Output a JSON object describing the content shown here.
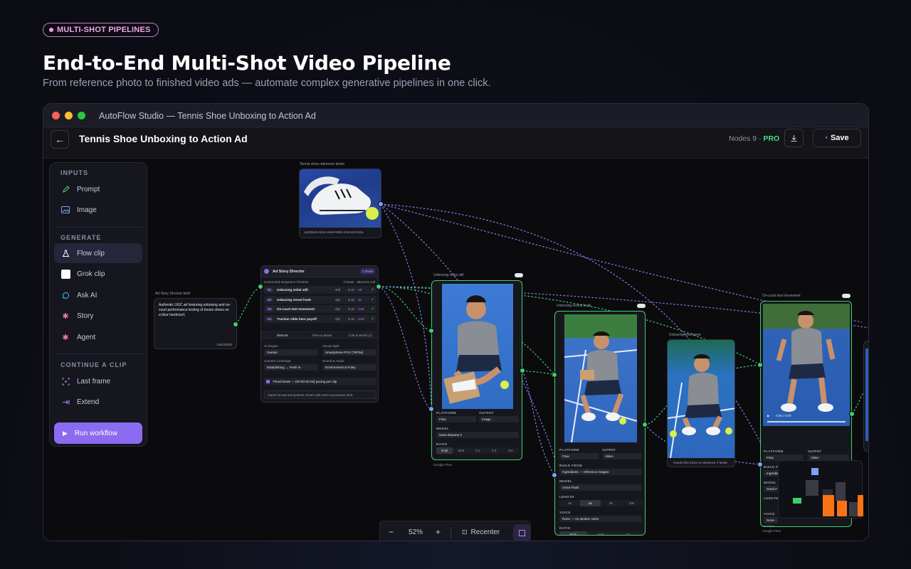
{
  "badge": "MULTI-SHOT PIPELINES",
  "headline": "End-to-End Multi-Shot Video Pipeline",
  "subheadline": "From reference photo to finished video ads — automate complex generative pipelines in one click.",
  "window": {
    "title": "AutoFlow Studio — Tennis Shoe Unboxing to Action Ad"
  },
  "topbar": {
    "title": "Tennis Shoe Unboxing to Action Ad",
    "nodes_label": "Nodes 9 ·",
    "tier": "PRO",
    "save_label": "Save"
  },
  "sidebar": {
    "inputs_label": "INPUTS",
    "generate_label": "GENERATE",
    "continue_label": "CONTINUE A CLIP",
    "inputs": [
      {
        "label": "Prompt",
        "icon": "pencil-icon"
      },
      {
        "label": "Image",
        "icon": "image-icon"
      }
    ],
    "generate": [
      {
        "label": "Flow clip",
        "icon": "flask-icon"
      },
      {
        "label": "Grok clip",
        "icon": "square-icon"
      },
      {
        "label": "Ask AI",
        "icon": "chat-icon"
      },
      {
        "label": "Story",
        "icon": "gear-icon"
      },
      {
        "label": "Agent",
        "icon": "gear-icon"
      }
    ],
    "continue": [
      {
        "label": "Last frame",
        "icon": "frame-icon"
      },
      {
        "label": "Extend",
        "icon": "extend-icon"
      }
    ],
    "run_label": "Run workflow"
  },
  "nodes": {
    "ref_photo": {
      "label": "Tennis shoe reference photo",
      "caption": "1a1f86c6-d42e-49e8-9050-410ce57eb2a"
    },
    "brief": {
      "label": "Ad Story Director brief",
      "text": "Authentic UGC ad featuring unboxing and on-court performance testing of tennis shoes on a blue hardcourt.",
      "count": "105/20000"
    },
    "director": {
      "title": "Ad Story Director",
      "shots": "4 Shots",
      "timeline_label": "Connected Sequence Timeline",
      "timeline_meta": "3 beats · about its cell",
      "beats": [
        {
          "n": "01",
          "name": "Unboxing initial still",
          "tag": "still",
          "ratio": "9:16",
          "kind": "ref"
        },
        {
          "n": "02",
          "name": "Unboxing reveal hook",
          "tag": "clip",
          "ratio": "9:16",
          "kind": "4s"
        },
        {
          "n": "03",
          "name": "On-court test movement",
          "tag": "clip",
          "ratio": "9:16",
          "kind": "cont"
        },
        {
          "n": "04",
          "name": "Traction slide hero payoff",
          "tag": "clip",
          "ratio": "9:16",
          "kind": "cont"
        }
      ],
      "tabs": [
        "Director",
        "Flow & Beats",
        "Cost & World (1)"
      ],
      "fields": [
        {
          "label": "AI Engine",
          "value": "Gemini"
        },
        {
          "label": "Visual Style",
          "value": "Smartphone POV (TikTok)"
        },
        {
          "label": "Camera Coverage",
          "value": "Establishing → Push In"
        },
        {
          "label": "Sound & Audio",
          "value": "Environment & Foley"
        }
      ],
      "timed": "Timed beats — [00:00-00:02] pacing per clip",
      "prompt": "Opens broad and pushes closer with each successive shot."
    },
    "still": {
      "label": "Unboxing initial still",
      "platform": "Flow",
      "output": "Image",
      "model": "Nano Banana 2",
      "ratios": [
        "9:16",
        "16:9",
        "1:1",
        "4:3",
        "3:4"
      ],
      "footer": "Google Flow"
    },
    "reveal": {
      "label": "Unboxing reveal hook",
      "platform": "Flow",
      "output": "Video",
      "build": "Ingredients — reference images",
      "model": "Omni Flash",
      "lengths": [
        "4s",
        "6s",
        "8s",
        "10s"
      ],
      "voice": "None — no spoken voice",
      "ratios": [
        "9:16",
        "16:9",
        "1:1"
      ]
    },
    "frame": {
      "label": "Unboxing end frame",
      "caption": "Hands this frame to whatever it feeds"
    },
    "court": {
      "label": "On-court test movement",
      "time": "0:00 / 0:00",
      "platform": "Flow",
      "output": "Video",
      "build": "Ingredients — reference images",
      "model": "Omni F",
      "voice": "None -",
      "ratios": [
        "9:16",
        "16:9",
        "1:1"
      ],
      "footer": "Google Flow"
    }
  },
  "field_labels": {
    "platform": "PLATFORM",
    "output": "OUTPUT",
    "model": "MODEL",
    "ratio": "RATIO",
    "build": "BUILD FROM",
    "length": "LENGTH",
    "voice": "VOICE"
  },
  "zoom": {
    "minus": "−",
    "level": "52%",
    "plus": "+",
    "recenter": "Recenter"
  },
  "colors": {
    "accent": "#8b6cf0",
    "success": "#3ecf6e",
    "port_blue": "#7aa2f7"
  }
}
